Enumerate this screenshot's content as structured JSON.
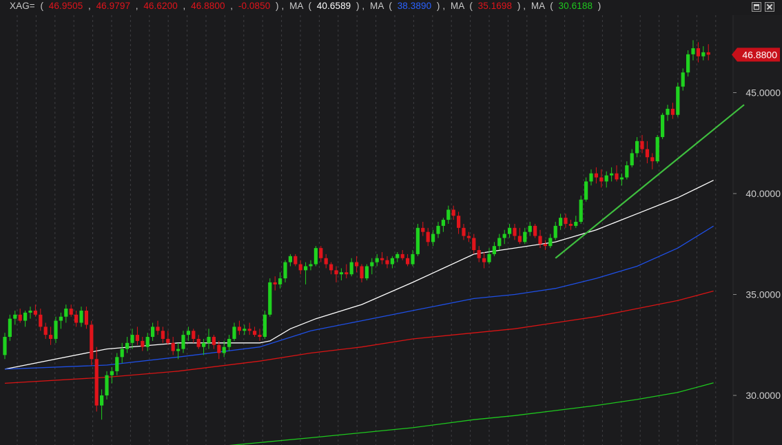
{
  "header": {
    "symbol": "XAG=",
    "open": "46.9505",
    "high": "46.9797",
    "low": "46.6200",
    "close": "46.8800",
    "change": "-0.0850",
    "ma_label": "MA",
    "ma_values": [
      "40.6589",
      "38.3890",
      "35.1698",
      "30.6188"
    ]
  },
  "colors": {
    "background": "#1b1b1d",
    "up": "#1fd21f",
    "down": "#e0141b",
    "ohlc_text": "#e0141b",
    "ma": [
      "#ffffff",
      "#1e4fe6",
      "#d81414",
      "#1ec81e"
    ],
    "trendline": "#3fbf3f",
    "price_tag": "#c8101a"
  },
  "chart_data": {
    "type": "candlestick",
    "y_ticks": [
      "30.0000",
      "35.0000",
      "40.0000",
      "45.0000"
    ],
    "ylim": [
      27.5,
      48.9
    ],
    "last_price": "46.8800",
    "grid": "vertical dashed",
    "candles": [
      [
        32.0,
        33.1,
        31.8,
        32.9
      ],
      [
        32.9,
        34.0,
        32.7,
        33.8
      ],
      [
        33.8,
        34.2,
        33.5,
        34.0
      ],
      [
        34.0,
        34.3,
        33.6,
        33.7
      ],
      [
        33.7,
        34.2,
        33.4,
        34.1
      ],
      [
        34.1,
        34.4,
        33.8,
        34.2
      ],
      [
        34.2,
        34.5,
        33.9,
        34.0
      ],
      [
        34.0,
        34.3,
        33.2,
        33.4
      ],
      [
        33.4,
        33.6,
        32.8,
        33.0
      ],
      [
        33.0,
        33.4,
        32.5,
        32.8
      ],
      [
        32.8,
        33.9,
        32.6,
        33.7
      ],
      [
        33.7,
        34.1,
        33.3,
        33.9
      ],
      [
        33.9,
        34.5,
        33.6,
        34.3
      ],
      [
        34.3,
        34.5,
        33.9,
        34.0
      ],
      [
        34.0,
        34.2,
        33.4,
        33.6
      ],
      [
        33.6,
        34.4,
        33.4,
        34.2
      ],
      [
        34.2,
        34.4,
        33.3,
        33.5
      ],
      [
        33.5,
        33.7,
        31.5,
        31.8
      ],
      [
        31.8,
        32.4,
        29.2,
        29.5
      ],
      [
        29.5,
        30.3,
        28.8,
        30.0
      ],
      [
        30.0,
        31.2,
        29.8,
        31.0
      ],
      [
        31.0,
        31.4,
        30.6,
        31.2
      ],
      [
        31.2,
        32.1,
        31.0,
        31.9
      ],
      [
        31.9,
        32.6,
        31.6,
        32.3
      ],
      [
        32.3,
        32.9,
        32.1,
        32.6
      ],
      [
        32.6,
        33.3,
        32.3,
        33.0
      ],
      [
        33.0,
        33.4,
        32.5,
        32.7
      ],
      [
        32.7,
        32.9,
        32.2,
        32.4
      ],
      [
        32.4,
        33.1,
        32.2,
        32.9
      ],
      [
        32.9,
        33.6,
        32.7,
        33.4
      ],
      [
        33.4,
        33.7,
        33.0,
        33.2
      ],
      [
        33.2,
        33.4,
        32.6,
        32.8
      ],
      [
        32.8,
        33.2,
        32.5,
        32.6
      ],
      [
        32.6,
        32.9,
        32.0,
        32.2
      ],
      [
        32.2,
        32.6,
        31.8,
        32.3
      ],
      [
        32.3,
        33.2,
        32.1,
        33.0
      ],
      [
        33.0,
        33.4,
        32.7,
        33.2
      ],
      [
        33.2,
        33.3,
        32.6,
        32.8
      ],
      [
        32.8,
        33.0,
        32.3,
        32.4
      ],
      [
        32.4,
        32.8,
        32.0,
        32.6
      ],
      [
        32.6,
        33.3,
        32.3,
        32.9
      ],
      [
        32.9,
        33.0,
        32.3,
        32.5
      ],
      [
        32.5,
        32.7,
        31.8,
        32.1
      ],
      [
        32.1,
        32.7,
        31.9,
        32.4
      ],
      [
        32.4,
        33.0,
        32.2,
        32.8
      ],
      [
        32.8,
        33.6,
        32.7,
        33.4
      ],
      [
        33.4,
        33.7,
        33.0,
        33.2
      ],
      [
        33.2,
        33.5,
        33.0,
        33.3
      ],
      [
        33.3,
        33.6,
        33.0,
        33.2
      ],
      [
        33.2,
        33.4,
        32.9,
        33.0
      ],
      [
        33.0,
        33.3,
        32.7,
        32.9
      ],
      [
        32.9,
        34.2,
        32.8,
        34.0
      ],
      [
        34.0,
        35.8,
        33.9,
        35.6
      ],
      [
        35.6,
        35.9,
        35.2,
        35.5
      ],
      [
        35.5,
        36.1,
        35.3,
        35.8
      ],
      [
        35.8,
        36.7,
        35.6,
        36.6
      ],
      [
        36.6,
        37.0,
        36.4,
        36.9
      ],
      [
        36.9,
        37.0,
        36.4,
        36.5
      ],
      [
        36.5,
        36.7,
        36.0,
        36.2
      ],
      [
        36.2,
        36.6,
        35.5,
        36.4
      ],
      [
        36.4,
        36.7,
        36.2,
        36.5
      ],
      [
        36.5,
        37.4,
        36.4,
        37.3
      ],
      [
        37.3,
        37.4,
        36.6,
        36.8
      ],
      [
        36.8,
        37.0,
        36.3,
        36.5
      ],
      [
        36.5,
        36.6,
        36.0,
        36.2
      ],
      [
        36.2,
        36.4,
        35.6,
        36.0
      ],
      [
        36.0,
        36.3,
        35.7,
        36.1
      ],
      [
        36.1,
        36.5,
        35.8,
        36.0
      ],
      [
        36.0,
        36.8,
        35.9,
        36.6
      ],
      [
        36.6,
        36.9,
        36.1,
        36.4
      ],
      [
        36.4,
        36.5,
        35.6,
        35.8
      ],
      [
        35.8,
        36.5,
        35.7,
        36.4
      ],
      [
        36.4,
        36.8,
        36.0,
        36.6
      ],
      [
        36.6,
        37.0,
        36.4,
        36.8
      ],
      [
        36.8,
        37.1,
        36.5,
        36.7
      ],
      [
        36.7,
        36.9,
        36.3,
        36.5
      ],
      [
        36.5,
        36.9,
        36.3,
        36.8
      ],
      [
        36.8,
        37.1,
        36.6,
        37.0
      ],
      [
        37.0,
        37.2,
        36.7,
        36.8
      ],
      [
        36.8,
        37.0,
        36.4,
        36.5
      ],
      [
        36.5,
        37.2,
        36.4,
        37.0
      ],
      [
        37.0,
        38.5,
        36.9,
        38.3
      ],
      [
        38.3,
        38.6,
        37.9,
        38.1
      ],
      [
        38.1,
        38.3,
        37.4,
        37.6
      ],
      [
        37.6,
        38.2,
        37.4,
        38.0
      ],
      [
        38.0,
        38.6,
        37.8,
        38.4
      ],
      [
        38.4,
        38.8,
        38.1,
        38.7
      ],
      [
        38.7,
        39.4,
        38.5,
        39.2
      ],
      [
        39.2,
        39.4,
        38.7,
        38.9
      ],
      [
        38.9,
        39.1,
        38.0,
        38.3
      ],
      [
        38.3,
        38.5,
        37.7,
        37.9
      ],
      [
        37.9,
        38.1,
        37.6,
        37.8
      ],
      [
        37.8,
        38.0,
        37.0,
        37.2
      ],
      [
        37.2,
        37.4,
        36.6,
        36.8
      ],
      [
        36.8,
        37.1,
        36.3,
        36.6
      ],
      [
        36.6,
        37.3,
        36.5,
        37.0
      ],
      [
        37.0,
        37.6,
        36.9,
        37.4
      ],
      [
        37.4,
        38.0,
        37.2,
        37.8
      ],
      [
        37.8,
        38.2,
        37.5,
        38.0
      ],
      [
        38.0,
        38.5,
        37.8,
        38.3
      ],
      [
        38.3,
        38.5,
        37.7,
        37.9
      ],
      [
        37.9,
        38.3,
        37.5,
        37.6
      ],
      [
        37.6,
        38.3,
        37.5,
        38.1
      ],
      [
        38.1,
        38.6,
        37.9,
        38.4
      ],
      [
        38.4,
        38.5,
        37.8,
        37.9
      ],
      [
        37.9,
        38.2,
        37.3,
        37.5
      ],
      [
        37.5,
        37.7,
        37.2,
        37.4
      ],
      [
        37.4,
        38.0,
        37.3,
        37.8
      ],
      [
        37.8,
        38.6,
        37.7,
        38.4
      ],
      [
        38.4,
        39.0,
        38.2,
        38.8
      ],
      [
        38.8,
        39.0,
        38.3,
        38.5
      ],
      [
        38.5,
        38.7,
        38.2,
        38.4
      ],
      [
        38.4,
        38.9,
        38.3,
        38.6
      ],
      [
        38.6,
        39.9,
        38.5,
        39.7
      ],
      [
        39.7,
        40.8,
        39.6,
        40.6
      ],
      [
        40.6,
        41.2,
        40.4,
        41.0
      ],
      [
        41.0,
        41.3,
        40.5,
        40.8
      ],
      [
        40.8,
        41.2,
        40.3,
        40.6
      ],
      [
        40.6,
        41.1,
        40.3,
        40.9
      ],
      [
        40.9,
        41.3,
        40.6,
        41.0
      ],
      [
        41.0,
        41.4,
        40.6,
        40.7
      ],
      [
        40.7,
        41.0,
        40.4,
        40.8
      ],
      [
        40.8,
        41.6,
        40.7,
        41.4
      ],
      [
        41.4,
        42.2,
        41.3,
        42.0
      ],
      [
        42.0,
        42.8,
        41.8,
        42.6
      ],
      [
        42.6,
        42.9,
        42.0,
        42.2
      ],
      [
        42.2,
        42.6,
        41.5,
        41.8
      ],
      [
        41.8,
        42.0,
        41.2,
        41.6
      ],
      [
        41.6,
        42.9,
        41.5,
        42.8
      ],
      [
        42.8,
        44.0,
        42.7,
        43.9
      ],
      [
        43.9,
        44.4,
        43.6,
        44.2
      ],
      [
        44.2,
        44.5,
        43.7,
        43.9
      ],
      [
        43.9,
        45.5,
        43.8,
        45.3
      ],
      [
        45.3,
        46.2,
        45.1,
        46.0
      ],
      [
        46.0,
        47.1,
        45.8,
        46.9
      ],
      [
        46.9,
        47.6,
        46.6,
        47.2
      ],
      [
        47.2,
        47.5,
        46.5,
        46.8
      ],
      [
        46.8,
        47.3,
        46.6,
        47.0
      ],
      [
        47.0,
        47.4,
        46.6,
        46.88
      ]
    ],
    "moving_averages": [
      {
        "value_label": "40.6589",
        "points": [
          [
            0,
            31.3
          ],
          [
            20,
            32.3
          ],
          [
            34,
            32.6
          ],
          [
            50,
            32.6
          ],
          [
            52,
            32.7
          ],
          [
            56,
            33.3
          ],
          [
            61,
            33.8
          ],
          [
            70,
            34.5
          ],
          [
            80,
            35.6
          ],
          [
            92,
            37.0
          ],
          [
            100,
            37.3
          ],
          [
            108,
            37.6
          ],
          [
            116,
            38.2
          ],
          [
            124,
            39.0
          ],
          [
            132,
            39.8
          ],
          [
            139,
            40.66
          ]
        ]
      },
      {
        "value_label": "38.3890",
        "points": [
          [
            0,
            31.3
          ],
          [
            20,
            31.5
          ],
          [
            34,
            31.9
          ],
          [
            50,
            32.4
          ],
          [
            60,
            33.2
          ],
          [
            70,
            33.7
          ],
          [
            80,
            34.2
          ],
          [
            92,
            34.8
          ],
          [
            100,
            35.0
          ],
          [
            108,
            35.3
          ],
          [
            116,
            35.8
          ],
          [
            124,
            36.4
          ],
          [
            132,
            37.3
          ],
          [
            139,
            38.39
          ]
        ]
      },
      {
        "value_label": "35.1698",
        "points": [
          [
            0,
            30.6
          ],
          [
            20,
            30.9
          ],
          [
            34,
            31.2
          ],
          [
            50,
            31.7
          ],
          [
            60,
            32.1
          ],
          [
            70,
            32.4
          ],
          [
            80,
            32.8
          ],
          [
            92,
            33.1
          ],
          [
            100,
            33.3
          ],
          [
            108,
            33.6
          ],
          [
            116,
            33.9
          ],
          [
            124,
            34.3
          ],
          [
            132,
            34.7
          ],
          [
            139,
            35.17
          ]
        ]
      },
      {
        "value_label": "30.6188",
        "points": [
          [
            43,
            27.5
          ],
          [
            60,
            27.9
          ],
          [
            80,
            28.4
          ],
          [
            92,
            28.8
          ],
          [
            100,
            29.0
          ],
          [
            108,
            29.25
          ],
          [
            116,
            29.5
          ],
          [
            124,
            29.8
          ],
          [
            132,
            30.15
          ],
          [
            139,
            30.62
          ]
        ]
      }
    ],
    "trendline": [
      [
        108,
        36.8
      ],
      [
        145,
        44.4
      ]
    ]
  }
}
